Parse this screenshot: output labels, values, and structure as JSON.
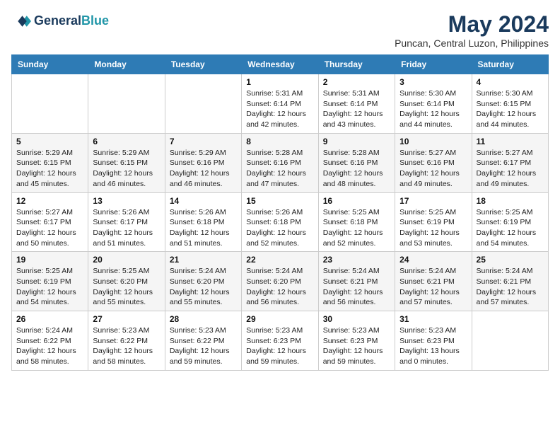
{
  "header": {
    "logo_line1": "General",
    "logo_line2": "Blue",
    "month_title": "May 2024",
    "location": "Puncan, Central Luzon, Philippines"
  },
  "weekdays": [
    "Sunday",
    "Monday",
    "Tuesday",
    "Wednesday",
    "Thursday",
    "Friday",
    "Saturday"
  ],
  "weeks": [
    [
      {
        "day": "",
        "info": ""
      },
      {
        "day": "",
        "info": ""
      },
      {
        "day": "",
        "info": ""
      },
      {
        "day": "1",
        "info": "Sunrise: 5:31 AM\nSunset: 6:14 PM\nDaylight: 12 hours\nand 42 minutes."
      },
      {
        "day": "2",
        "info": "Sunrise: 5:31 AM\nSunset: 6:14 PM\nDaylight: 12 hours\nand 43 minutes."
      },
      {
        "day": "3",
        "info": "Sunrise: 5:30 AM\nSunset: 6:14 PM\nDaylight: 12 hours\nand 44 minutes."
      },
      {
        "day": "4",
        "info": "Sunrise: 5:30 AM\nSunset: 6:15 PM\nDaylight: 12 hours\nand 44 minutes."
      }
    ],
    [
      {
        "day": "5",
        "info": "Sunrise: 5:29 AM\nSunset: 6:15 PM\nDaylight: 12 hours\nand 45 minutes."
      },
      {
        "day": "6",
        "info": "Sunrise: 5:29 AM\nSunset: 6:15 PM\nDaylight: 12 hours\nand 46 minutes."
      },
      {
        "day": "7",
        "info": "Sunrise: 5:29 AM\nSunset: 6:16 PM\nDaylight: 12 hours\nand 46 minutes."
      },
      {
        "day": "8",
        "info": "Sunrise: 5:28 AM\nSunset: 6:16 PM\nDaylight: 12 hours\nand 47 minutes."
      },
      {
        "day": "9",
        "info": "Sunrise: 5:28 AM\nSunset: 6:16 PM\nDaylight: 12 hours\nand 48 minutes."
      },
      {
        "day": "10",
        "info": "Sunrise: 5:27 AM\nSunset: 6:16 PM\nDaylight: 12 hours\nand 49 minutes."
      },
      {
        "day": "11",
        "info": "Sunrise: 5:27 AM\nSunset: 6:17 PM\nDaylight: 12 hours\nand 49 minutes."
      }
    ],
    [
      {
        "day": "12",
        "info": "Sunrise: 5:27 AM\nSunset: 6:17 PM\nDaylight: 12 hours\nand 50 minutes."
      },
      {
        "day": "13",
        "info": "Sunrise: 5:26 AM\nSunset: 6:17 PM\nDaylight: 12 hours\nand 51 minutes."
      },
      {
        "day": "14",
        "info": "Sunrise: 5:26 AM\nSunset: 6:18 PM\nDaylight: 12 hours\nand 51 minutes."
      },
      {
        "day": "15",
        "info": "Sunrise: 5:26 AM\nSunset: 6:18 PM\nDaylight: 12 hours\nand 52 minutes."
      },
      {
        "day": "16",
        "info": "Sunrise: 5:25 AM\nSunset: 6:18 PM\nDaylight: 12 hours\nand 52 minutes."
      },
      {
        "day": "17",
        "info": "Sunrise: 5:25 AM\nSunset: 6:19 PM\nDaylight: 12 hours\nand 53 minutes."
      },
      {
        "day": "18",
        "info": "Sunrise: 5:25 AM\nSunset: 6:19 PM\nDaylight: 12 hours\nand 54 minutes."
      }
    ],
    [
      {
        "day": "19",
        "info": "Sunrise: 5:25 AM\nSunset: 6:19 PM\nDaylight: 12 hours\nand 54 minutes."
      },
      {
        "day": "20",
        "info": "Sunrise: 5:25 AM\nSunset: 6:20 PM\nDaylight: 12 hours\nand 55 minutes."
      },
      {
        "day": "21",
        "info": "Sunrise: 5:24 AM\nSunset: 6:20 PM\nDaylight: 12 hours\nand 55 minutes."
      },
      {
        "day": "22",
        "info": "Sunrise: 5:24 AM\nSunset: 6:20 PM\nDaylight: 12 hours\nand 56 minutes."
      },
      {
        "day": "23",
        "info": "Sunrise: 5:24 AM\nSunset: 6:21 PM\nDaylight: 12 hours\nand 56 minutes."
      },
      {
        "day": "24",
        "info": "Sunrise: 5:24 AM\nSunset: 6:21 PM\nDaylight: 12 hours\nand 57 minutes."
      },
      {
        "day": "25",
        "info": "Sunrise: 5:24 AM\nSunset: 6:21 PM\nDaylight: 12 hours\nand 57 minutes."
      }
    ],
    [
      {
        "day": "26",
        "info": "Sunrise: 5:24 AM\nSunset: 6:22 PM\nDaylight: 12 hours\nand 58 minutes."
      },
      {
        "day": "27",
        "info": "Sunrise: 5:23 AM\nSunset: 6:22 PM\nDaylight: 12 hours\nand 58 minutes."
      },
      {
        "day": "28",
        "info": "Sunrise: 5:23 AM\nSunset: 6:22 PM\nDaylight: 12 hours\nand 59 minutes."
      },
      {
        "day": "29",
        "info": "Sunrise: 5:23 AM\nSunset: 6:23 PM\nDaylight: 12 hours\nand 59 minutes."
      },
      {
        "day": "30",
        "info": "Sunrise: 5:23 AM\nSunset: 6:23 PM\nDaylight: 12 hours\nand 59 minutes."
      },
      {
        "day": "31",
        "info": "Sunrise: 5:23 AM\nSunset: 6:23 PM\nDaylight: 13 hours\nand 0 minutes."
      },
      {
        "day": "",
        "info": ""
      }
    ]
  ]
}
